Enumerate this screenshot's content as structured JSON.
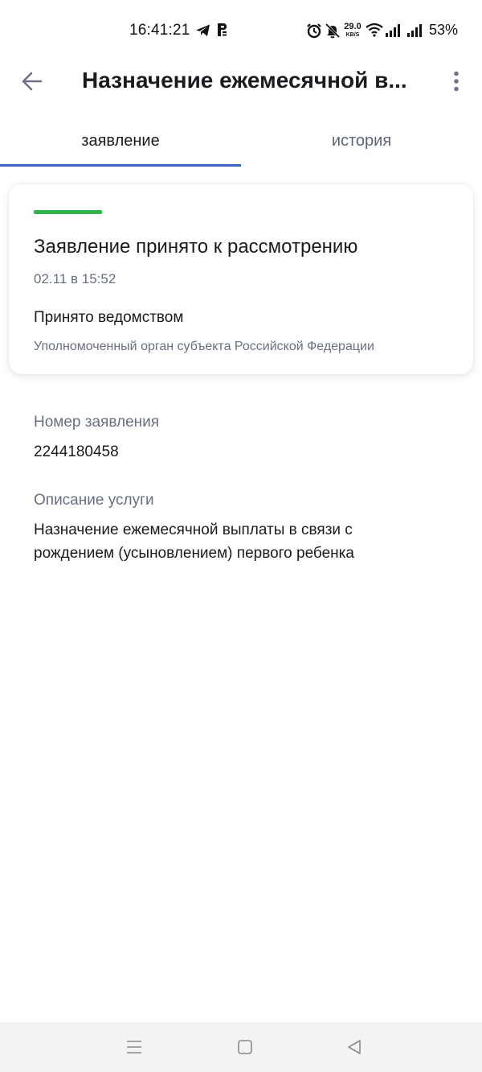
{
  "status_bar": {
    "time": "16:41:21",
    "net_speed_value": "29.0",
    "net_speed_unit": "KB/S",
    "battery": "53%"
  },
  "app_bar": {
    "title": "Назначение ежемесячной в...",
    "back_icon": "arrow-left-icon",
    "menu_icon": "more-vert-icon"
  },
  "tabs": [
    {
      "label": "заявление",
      "active": true
    },
    {
      "label": "история",
      "active": false
    }
  ],
  "status_card": {
    "progress_fraction": 1.0,
    "progress_color": "#32b44a",
    "title": "Заявление принято к рассмотрению",
    "date": "02.11 в 15:52",
    "department_label": "Принято ведомством",
    "department": "Уполномоченный орган субъекта Российской Федерации"
  },
  "details": {
    "number_label": "Номер заявления",
    "number_value": "2244180458",
    "description_label": "Описание услуги",
    "description_line1": "Назначение ежемесячной выплаты в связи с",
    "description_line2": "рождением (усыновлением) первого ребенка"
  },
  "colors": {
    "accent": "#3a66c2",
    "secondary_text": "#66707f"
  },
  "nav_bar": {
    "icons": [
      "menu-icon",
      "home-square-icon",
      "back-triangle-icon"
    ]
  }
}
